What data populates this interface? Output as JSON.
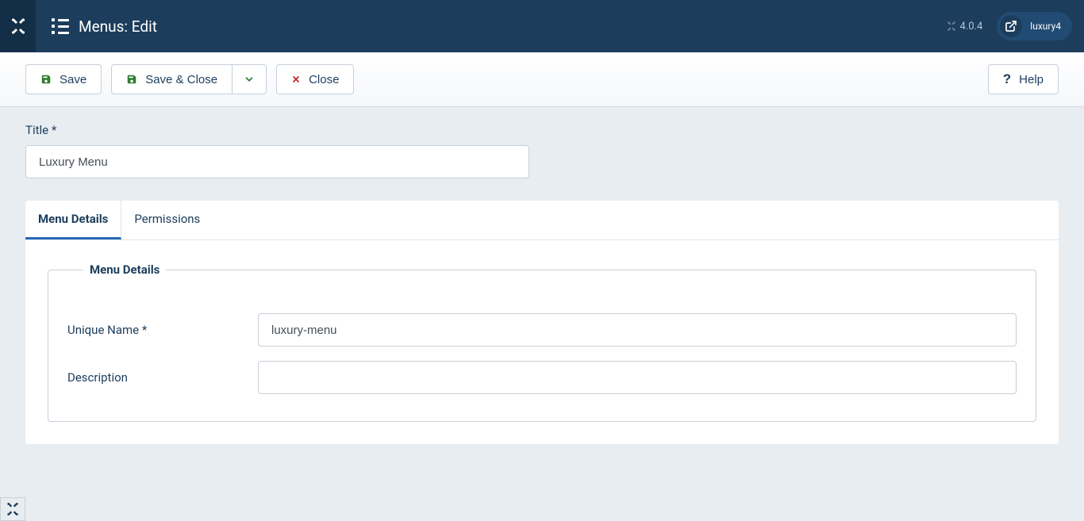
{
  "header": {
    "page_title": "Menus: Edit",
    "version": "4.0.4",
    "site_name": "luxury4"
  },
  "toolbar": {
    "save_label": "Save",
    "save_close_label": "Save & Close",
    "close_label": "Close",
    "help_label": "Help"
  },
  "form": {
    "title_label": "Title *",
    "title_value": "Luxury Menu"
  },
  "tabs": {
    "menu_details": "Menu Details",
    "permissions": "Permissions"
  },
  "details": {
    "legend": "Menu Details",
    "unique_name_label": "Unique Name *",
    "unique_name_value": "luxury-menu",
    "description_label": "Description",
    "description_value": ""
  }
}
